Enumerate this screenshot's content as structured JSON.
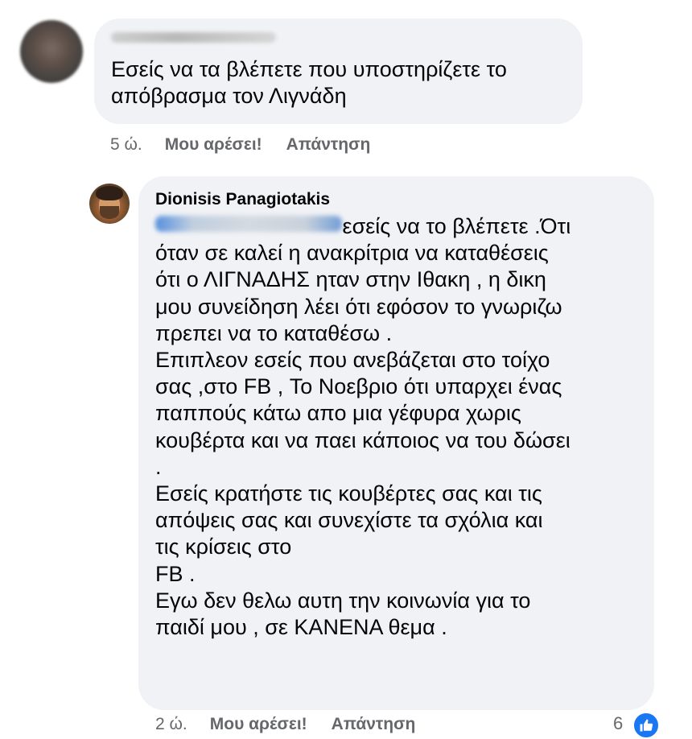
{
  "comments": [
    {
      "author": "",
      "author_redacted": true,
      "text": "Εσείς να τα βλέπετε που υποστηρίζετε το\nαπόβρασμα τον Λιγνάδη",
      "time": "5 ώ.",
      "like_label": "Μου αρέσει!",
      "reply_label": "Απάντηση"
    },
    {
      "author": "Dionisis Panagiotakis",
      "mention_redacted": true,
      "text": "                               εσείς να το βλέπετε .Ότι\nόταν σε καλεί η ανακρίτρια να καταθέσεις\nότι ο ΛΙΓΝΑΔΗΣ ηταν στην Ιθακη , η δικη\nμου συνείδηση λέει ότι εφόσον το γνωριζω\nπρεπει να το καταθέσω .\nΕπιπλεον εσείς που ανεβάζεται στο τοίχο\nσας ,στο FB , Το Νοεβριο ότι υπαρχει ένας\nπαππούς κάτω απο μια γέφυρα χωρις\nκουβέρτα και να παει κάποιος να του δώσει\n.\nΕσείς κρατήστε τις κουβέρτες σας και τις\nαπόψεις σας και συνεχίστε τα σχόλια και\nτις κρίσεις στο\nFB .\nΕγω δεν θελω αυτη την κοινωνία για το\nπαιδί μου , σε ΚΑΝΕΝΑ θεμα .",
      "time": "2 ώ.",
      "like_label": "Μου αρέσει!",
      "reply_label": "Απάντηση",
      "reaction_count": "6",
      "reaction_icon": "thumbs-up-icon",
      "reaction_color": "#1877f2"
    }
  ],
  "colors": {
    "bubble": "#f0f2f5",
    "meta_text": "#65676b",
    "body_text": "#050505"
  }
}
